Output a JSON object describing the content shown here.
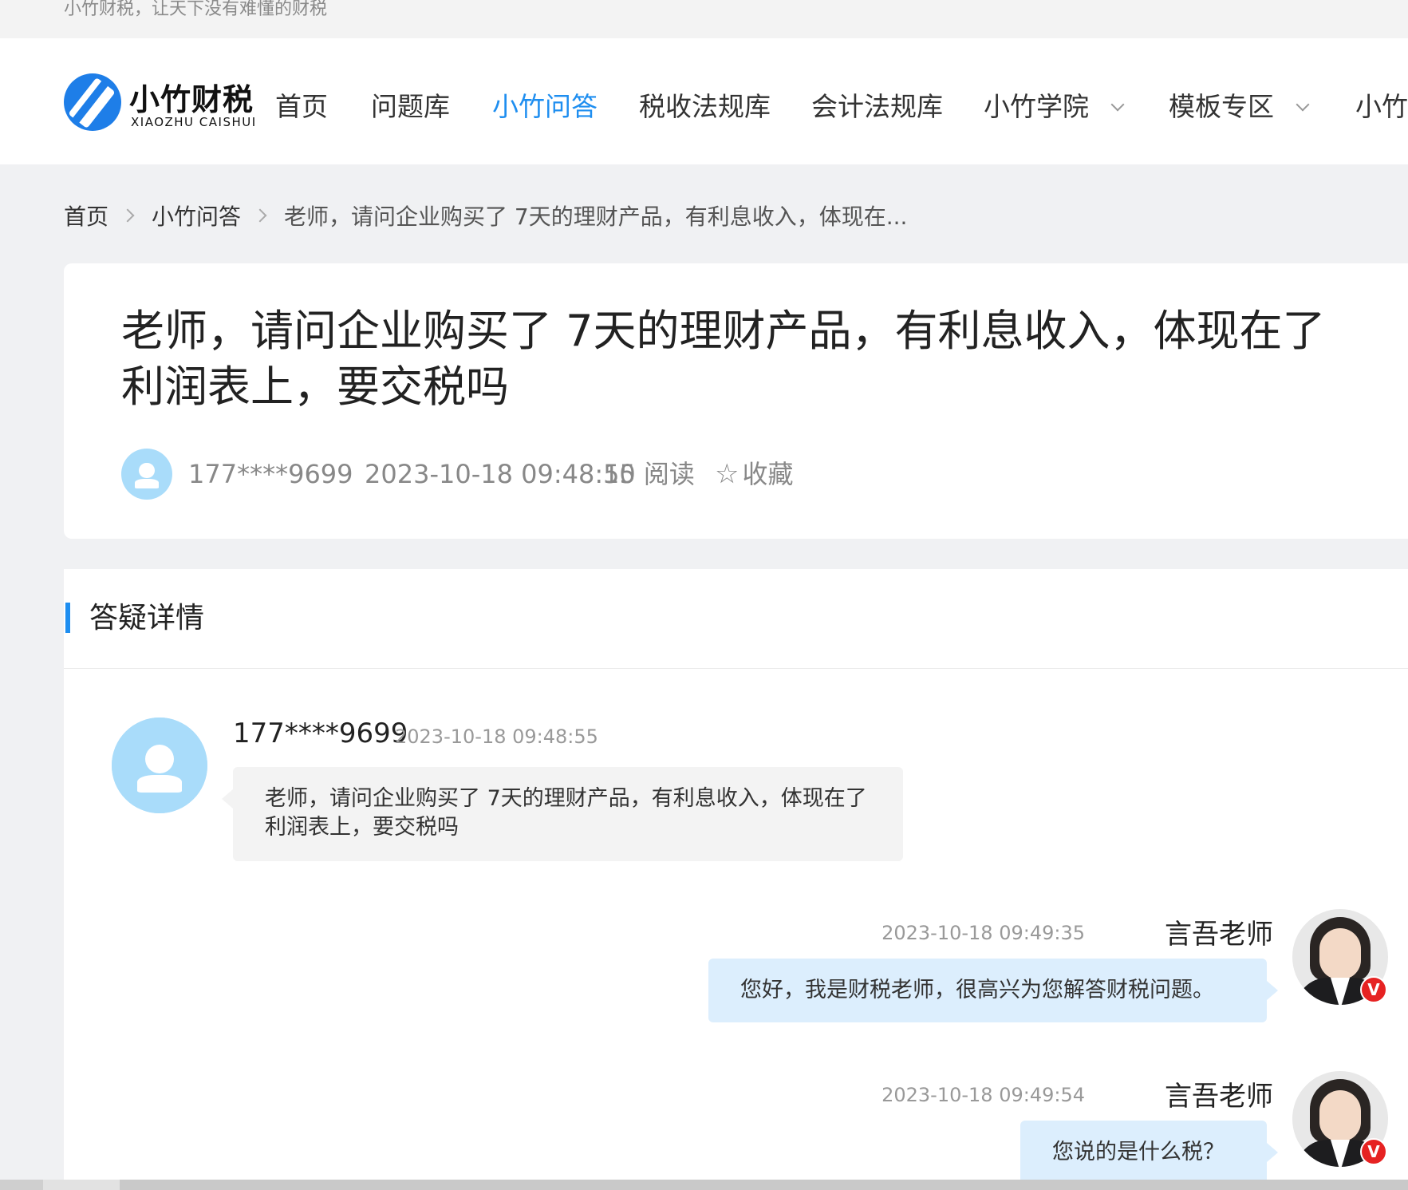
{
  "topbar": {
    "slogan": "小竹财税，让天下没有难懂的财税"
  },
  "logo": {
    "name_cn": "小竹财税",
    "name_en": "XIAOZHU CAISHUI"
  },
  "nav": {
    "items": [
      {
        "label": "首页"
      },
      {
        "label": "问题库"
      },
      {
        "label": "小竹问答",
        "active": true
      },
      {
        "label": "税收法规库"
      },
      {
        "label": "会计法规库"
      },
      {
        "label": "小竹学院",
        "dropdown": true
      },
      {
        "label": "模板专区",
        "dropdown": true
      },
      {
        "label": "小竹"
      }
    ],
    "accent_color": "#1e8ef0"
  },
  "breadcrumb": {
    "items": [
      "首页",
      "小竹问答"
    ],
    "current": "老师，请问企业购买了 7天的理财产品，有利息收入，体现在..."
  },
  "question": {
    "title": "老师，请问企业购买了 7天的理财产品，有利息收入，体现在了利润表上，要交税吗",
    "author": "177****9699",
    "time": "2023-10-18 09:48:55",
    "reads": "10 阅读",
    "favorite": "收藏"
  },
  "detail": {
    "section_title": "答疑详情",
    "messages": [
      {
        "role": "user",
        "name": "177****9699",
        "time": "2023-10-18 09:48:55",
        "text": "老师，请问企业购买了 7天的理财产品，有利息收入，体现在了利润表上，要交税吗"
      },
      {
        "role": "teacher",
        "name": "言吾老师",
        "time": "2023-10-18 09:49:35",
        "text": "您好，我是财税老师，很高兴为您解答财税问题。"
      },
      {
        "role": "teacher",
        "name": "言吾老师",
        "time": "2023-10-18 09:49:54",
        "text": "您说的是什么税？"
      }
    ],
    "badge": "V"
  }
}
